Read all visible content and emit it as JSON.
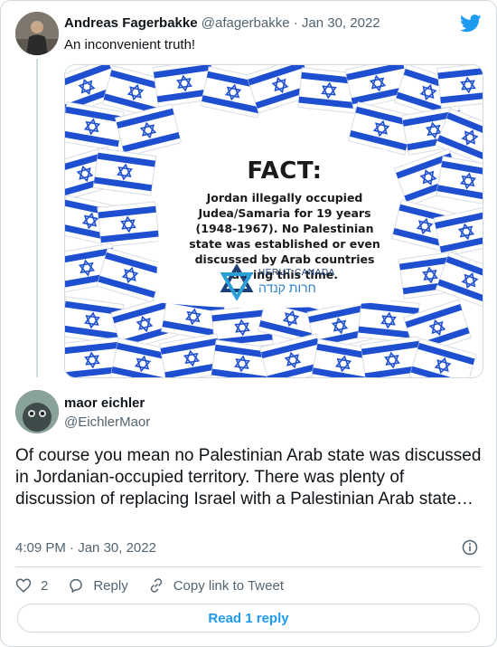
{
  "tweet": {
    "name": "Andreas Fagerbakke",
    "handle": "@afagerbakke",
    "separator": "·",
    "date": "Jan 30, 2022",
    "text": "An inconvenient truth!"
  },
  "image": {
    "fact_title": "FACT:",
    "fact_body": "Jordan illegally occupied Judea/Samaria for 19 years (1948-1967). No Palestinian state was established or even discussed by Arab countries during this time.",
    "org_en": "HERUT CANADA",
    "org_he": "חרות קנדה"
  },
  "reply": {
    "name": "maor eichler",
    "handle": "@EichlerMaor",
    "text": "Of course you mean no Palestinian Arab state was discussed in Jordanian-occupied territory. There was plenty of discussion of replacing Israel with a Palestinian Arab state…",
    "time": "4:09 PM",
    "separator": "·",
    "date": "Jan 30, 2022"
  },
  "actions": {
    "like_count": "2",
    "reply_label": "Reply",
    "copy_label": "Copy link to Tweet"
  },
  "read_reply_label": "Read 1 reply",
  "colors": {
    "accent": "#1d9bf0",
    "flag_blue": "#1f4fd1",
    "muted": "#536471",
    "border": "#cfd9de"
  },
  "icons": [
    "twitter-bird-icon",
    "info-icon",
    "heart-icon",
    "reply-icon",
    "link-icon",
    "star-of-david-icon"
  ]
}
